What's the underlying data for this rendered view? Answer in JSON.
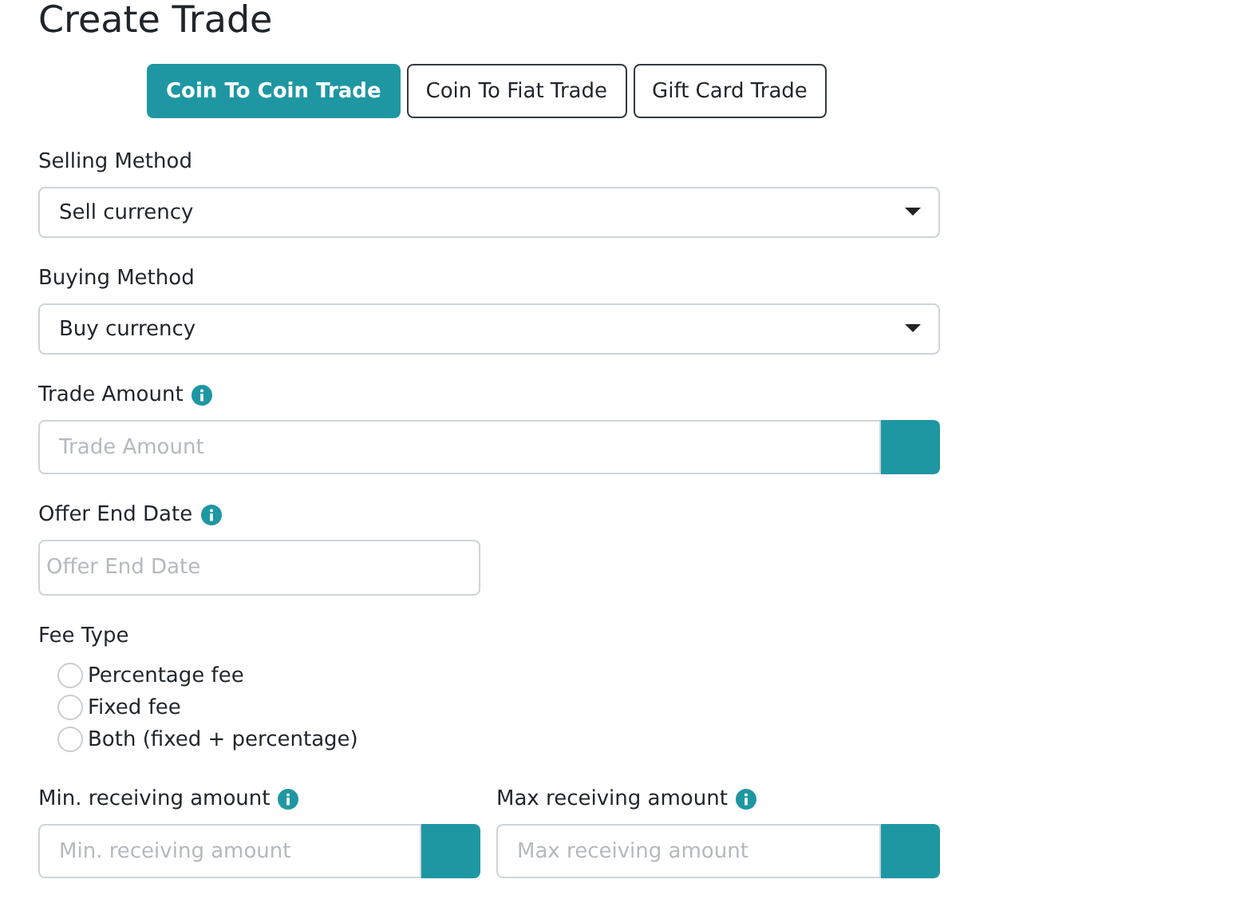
{
  "title": "Create Trade",
  "tabs": [
    {
      "label": "Coin To Coin Trade",
      "selected": true
    },
    {
      "label": "Coin To Fiat Trade",
      "selected": false
    },
    {
      "label": "Gift Card Trade",
      "selected": false
    }
  ],
  "selling_method": {
    "label": "Selling Method",
    "value": "Sell currency"
  },
  "buying_method": {
    "label": "Buying Method",
    "value": "Buy currency"
  },
  "trade_amount": {
    "label": "Trade Amount",
    "placeholder": "Trade Amount"
  },
  "offer_end_date": {
    "label": "Offer End Date",
    "placeholder": "Offer End Date"
  },
  "fee_type": {
    "label": "Fee Type",
    "options": [
      {
        "label": "Percentage fee",
        "selected": false
      },
      {
        "label": "Fixed fee",
        "selected": false
      },
      {
        "label": "Both (fixed + percentage)",
        "selected": false
      }
    ]
  },
  "min_receiving": {
    "label": "Min. receiving amount",
    "placeholder": "Min. receiving amount"
  },
  "max_receiving": {
    "label": "Max receiving amount",
    "placeholder": "Max receiving amount"
  }
}
